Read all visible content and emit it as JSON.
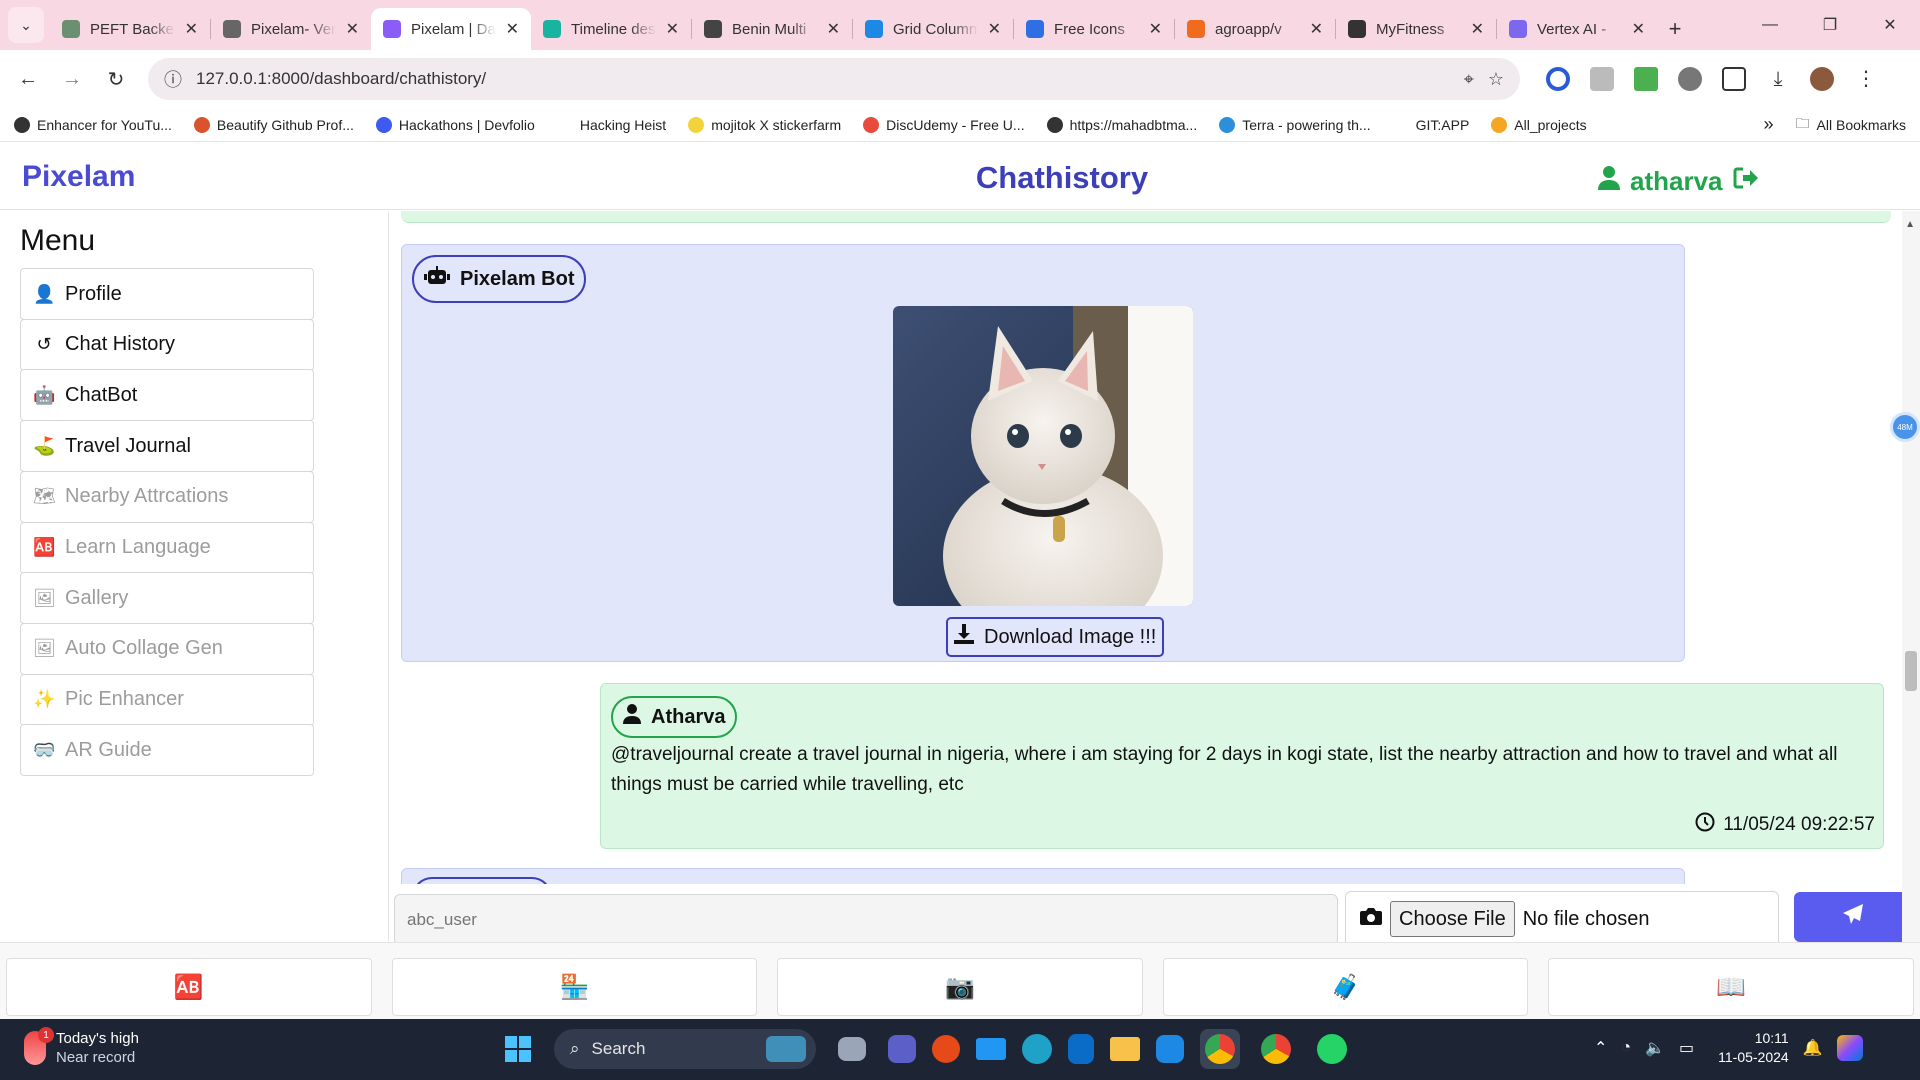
{
  "browser": {
    "tabs": [
      {
        "title": "PEFT Backend",
        "color": "#6b8f71"
      },
      {
        "title": "Pixelam- Vertex",
        "color": "#666666"
      },
      {
        "title": "Pixelam | Dashboard",
        "color": "#8b5cf6",
        "active": true
      },
      {
        "title": "Timeline design",
        "color": "#19b4a0"
      },
      {
        "title": "Benin Multi",
        "color": "#444444"
      },
      {
        "title": "Grid Columns",
        "color": "#1e88e5"
      },
      {
        "title": "Free Icons",
        "color": "#2f6fe4"
      },
      {
        "title": "agroapp/v",
        "color": "#f06b1e"
      },
      {
        "title": "MyFitness",
        "color": "#333333"
      },
      {
        "title": "Vertex AI -",
        "color": "#7b68ee"
      }
    ],
    "url": "127.0.0.1:8000/dashboard/chathistory/",
    "bookmarks": [
      {
        "label": "Enhancer for YouTu...",
        "color": "#333333"
      },
      {
        "label": "Beautify Github Prof...",
        "color": "#d9532c"
      },
      {
        "label": "Hackathons | Devfolio",
        "color": "#3d5af1"
      },
      {
        "label": "Hacking Heist",
        "color": "#ffffff"
      },
      {
        "label": "mojitok X stickerfarm",
        "color": "#f3d33b"
      },
      {
        "label": "DiscUdemy - Free U...",
        "color": "#e84b3c"
      },
      {
        "label": "https://mahadbtma...",
        "color": "#333333"
      },
      {
        "label": "Terra - powering th...",
        "color": "#2b90d9"
      },
      {
        "label": "GIT:APP",
        "color": "#ffffff"
      },
      {
        "label": "All_projects",
        "color": "#f5a623"
      }
    ],
    "more_bookmarks": "»",
    "all_bookmarks": "All Bookmarks"
  },
  "header": {
    "brand": "Pixelam",
    "title": "Chathistory",
    "username": "atharva"
  },
  "sidebar": {
    "title": "Menu",
    "items": [
      {
        "label": "Profile",
        "icon": "user-icon",
        "glyph": "👤",
        "enabled": true
      },
      {
        "label": "Chat History",
        "icon": "history-icon",
        "glyph": "↺",
        "enabled": true
      },
      {
        "label": "ChatBot",
        "icon": "robot-icon",
        "glyph": "🤖",
        "enabled": true
      },
      {
        "label": "Travel Journal",
        "icon": "route-icon",
        "glyph": "⛳",
        "enabled": true
      },
      {
        "label": "Nearby Attrcations",
        "icon": "map-icon",
        "glyph": "🗺",
        "enabled": false
      },
      {
        "label": "Learn Language",
        "icon": "language-icon",
        "glyph": "🆎",
        "enabled": false
      },
      {
        "label": "Gallery",
        "icon": "images-icon",
        "glyph": "🖼",
        "enabled": false
      },
      {
        "label": "Auto Collage Gen",
        "icon": "image-icon",
        "glyph": "🖼",
        "enabled": false
      },
      {
        "label": "Pic Enhancer",
        "icon": "magic-wand-icon",
        "glyph": "✨",
        "enabled": false
      },
      {
        "label": "AR Guide",
        "icon": "vr-cardboard-icon",
        "glyph": "🥽",
        "enabled": false
      }
    ]
  },
  "chat": {
    "bot_name": "Pixelam Bot",
    "download_label": "Download Image !!!",
    "user_name": "Atharva",
    "user_message": "@traveljournal create a travel journal in nigeria, where i am staying for 2 days in kogi state, list the nearby attraction and how to travel and what all things must be carried while travelling, etc",
    "user_timestamp": "11/05/24 09:22:57",
    "input_placeholder": "abc_user",
    "choose_file_label": "Choose File",
    "no_file_label": "No file chosen",
    "floating_badge": "48M"
  },
  "bottom_nav": [
    {
      "icon": "language-icon",
      "glyph": "🆎"
    },
    {
      "icon": "store-icon",
      "glyph": "🏪"
    },
    {
      "icon": "camera-icon",
      "glyph": "📷"
    },
    {
      "icon": "suitcase-medical-icon",
      "glyph": "🧳"
    },
    {
      "icon": "book-open-icon",
      "glyph": "📖"
    }
  ],
  "taskbar": {
    "weather_title": "Today's high",
    "weather_sub": "Near record",
    "weather_badge": "1",
    "search_label": "Search",
    "time": "10:11",
    "date": "11-05-2024"
  }
}
